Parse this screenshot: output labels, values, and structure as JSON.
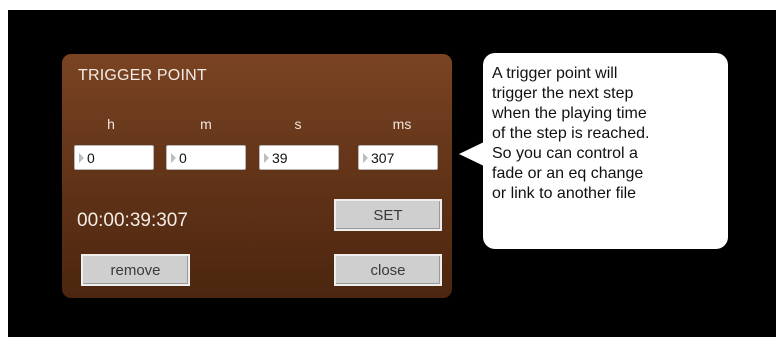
{
  "dialog": {
    "title": "TRIGGER POINT",
    "columns": [
      {
        "label": "h",
        "value": "0"
      },
      {
        "label": "m",
        "value": "0"
      },
      {
        "label": "s",
        "value": "39"
      },
      {
        "label": "ms",
        "value": "307"
      }
    ],
    "time_readout": "00:00:39:307",
    "set_label": "SET",
    "remove_label": "remove",
    "close_label": "close"
  },
  "tooltip": {
    "lines": [
      "A trigger point will",
      "trigger the next step",
      "when the playing time",
      "of the step is reached.",
      "So you can control a",
      "fade or an eq change",
      "or link to another file"
    ]
  },
  "colors": {
    "background": "#000000",
    "panel_top": "#7a4423",
    "panel_bottom": "#4c260f",
    "button_face": "#cfcfcf",
    "tooltip_bg": "#ffffff"
  }
}
